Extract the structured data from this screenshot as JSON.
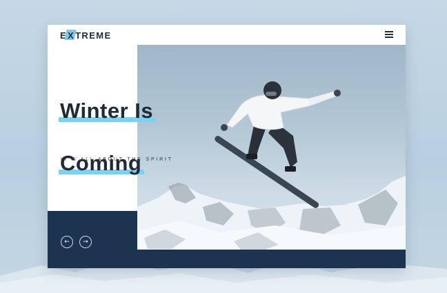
{
  "header": {
    "logo_prefix": "E",
    "logo_x": "X",
    "logo_suffix": "TREME",
    "menu_icon": "hamburger-menu-icon"
  },
  "hero": {
    "headline_line1": "Winter Is",
    "headline_line2": "Coming",
    "subtitle": "IT`S ALL ABOUT THE SPIRIT",
    "image_subject": "snowboarder-jumping-over-mountains"
  },
  "slider": {
    "prev_icon": "←",
    "next_icon": "→"
  },
  "colors": {
    "accent": "#7ed0ee",
    "navy": "#1d3450",
    "text": "#1f2a36"
  }
}
